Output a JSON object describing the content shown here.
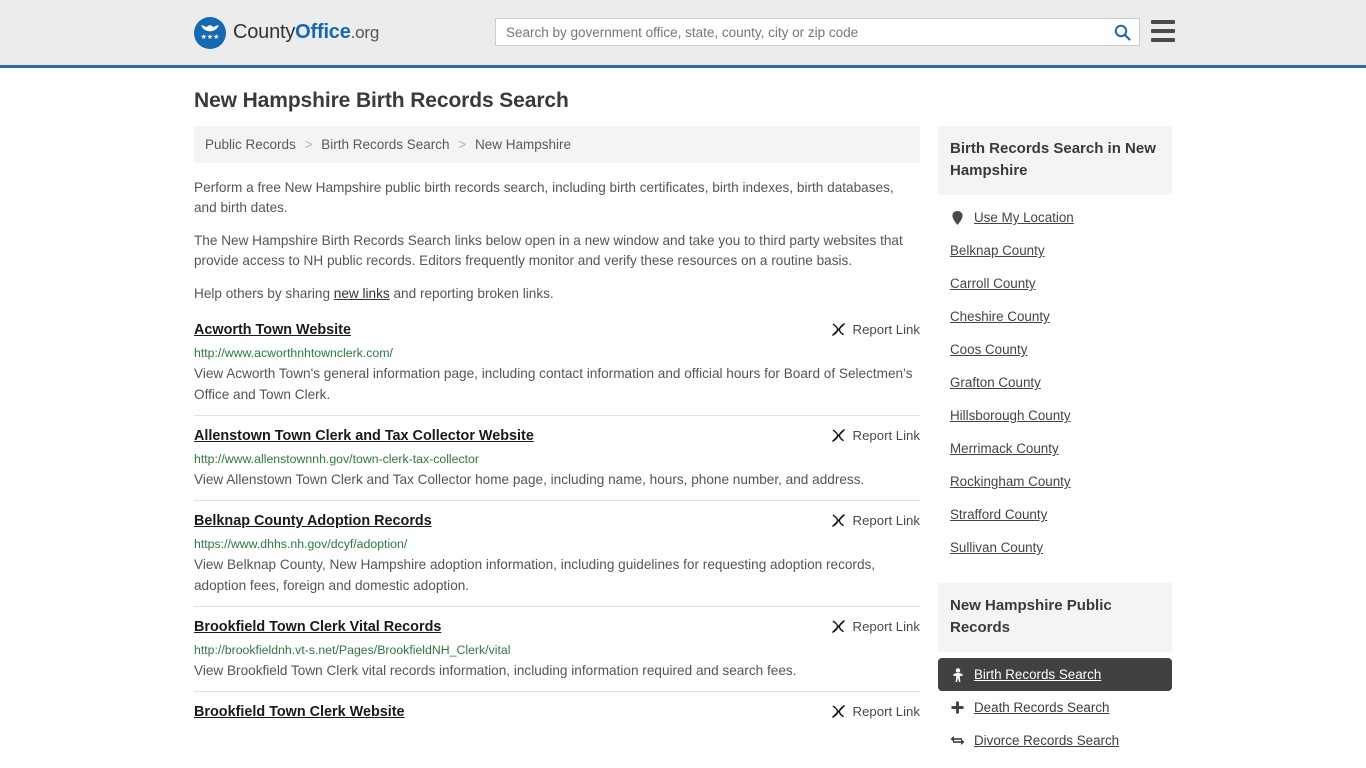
{
  "header": {
    "brand": {
      "part1": "County",
      "part2": "Office",
      "part3": ".org",
      "logo_icon": "eagle-stars-logo"
    },
    "search": {
      "placeholder": "Search by government office, state, county, city or zip code",
      "value": "",
      "icon": "search-icon"
    },
    "menu_icon": "hamburger-menu-icon",
    "border_color": "#2e6da4"
  },
  "page": {
    "title": "New Hampshire Birth Records Search"
  },
  "breadcrumb": {
    "items": [
      {
        "label": "Public Records",
        "current": false
      },
      {
        "label": "Birth Records Search",
        "current": false
      },
      {
        "label": "New Hampshire",
        "current": true
      }
    ],
    "separator": ">"
  },
  "intro": {
    "p1": "Perform a free New Hampshire public birth records search, including birth certificates, birth indexes, birth databases, and birth dates.",
    "p2": "The New Hampshire Birth Records Search links below open in a new window and take you to third party websites that provide access to NH public records. Editors frequently monitor and verify these resources on a routine basis.",
    "p3_before": "Help others by sharing ",
    "p3_link": "new links",
    "p3_after": " and reporting broken links."
  },
  "results": {
    "report_label": "Report Link",
    "report_icon": "broken-link-icon",
    "items": [
      {
        "title": "Acworth Town Website",
        "url": "http://www.acworthnhtownclerk.com/",
        "description": "View Acworth Town's general information page, including contact information and official hours for Board of Selectmen's Office and Town Clerk."
      },
      {
        "title": "Allenstown Town Clerk and Tax Collector Website",
        "url": "http://www.allenstownnh.gov/town-clerk-tax-collector",
        "description": "View Allenstown Town Clerk and Tax Collector home page, including name, hours, phone number, and address."
      },
      {
        "title": "Belknap County Adoption Records",
        "url": "https://www.dhhs.nh.gov/dcyf/adoption/",
        "description": "View Belknap County, New Hampshire adoption information, including guidelines for requesting adoption records, adoption fees, foreign and domestic adoption."
      },
      {
        "title": "Brookfield Town Clerk Vital Records",
        "url": "http://brookfieldnh.vt-s.net/Pages/BrookfieldNH_Clerk/vital",
        "description": "View Brookfield Town Clerk vital records information, including information required and search fees."
      },
      {
        "title": "Brookfield Town Clerk Website",
        "url": "",
        "description": ""
      }
    ]
  },
  "sidebar": {
    "counties_box": {
      "title": "Birth Records Search in New Hampshire",
      "use_my_location": {
        "label": "Use My Location",
        "icon": "location-pin-icon"
      },
      "counties": [
        {
          "label": "Belknap County"
        },
        {
          "label": "Carroll County"
        },
        {
          "label": "Cheshire County"
        },
        {
          "label": "Coos County"
        },
        {
          "label": "Grafton County"
        },
        {
          "label": "Hillsborough County"
        },
        {
          "label": "Merrimack County"
        },
        {
          "label": "Rockingham County"
        },
        {
          "label": "Strafford County"
        },
        {
          "label": "Sullivan County"
        }
      ]
    },
    "records_box": {
      "title": "New Hampshire Public Records",
      "links": [
        {
          "label": "Birth Records Search",
          "icon": "baby-icon",
          "active": true
        },
        {
          "label": "Death Records Search",
          "icon": "cross-icon",
          "active": false
        },
        {
          "label": "Divorce Records Search",
          "icon": "divorce-arrows-icon",
          "active": false
        }
      ],
      "active_bg": "#414141"
    }
  }
}
